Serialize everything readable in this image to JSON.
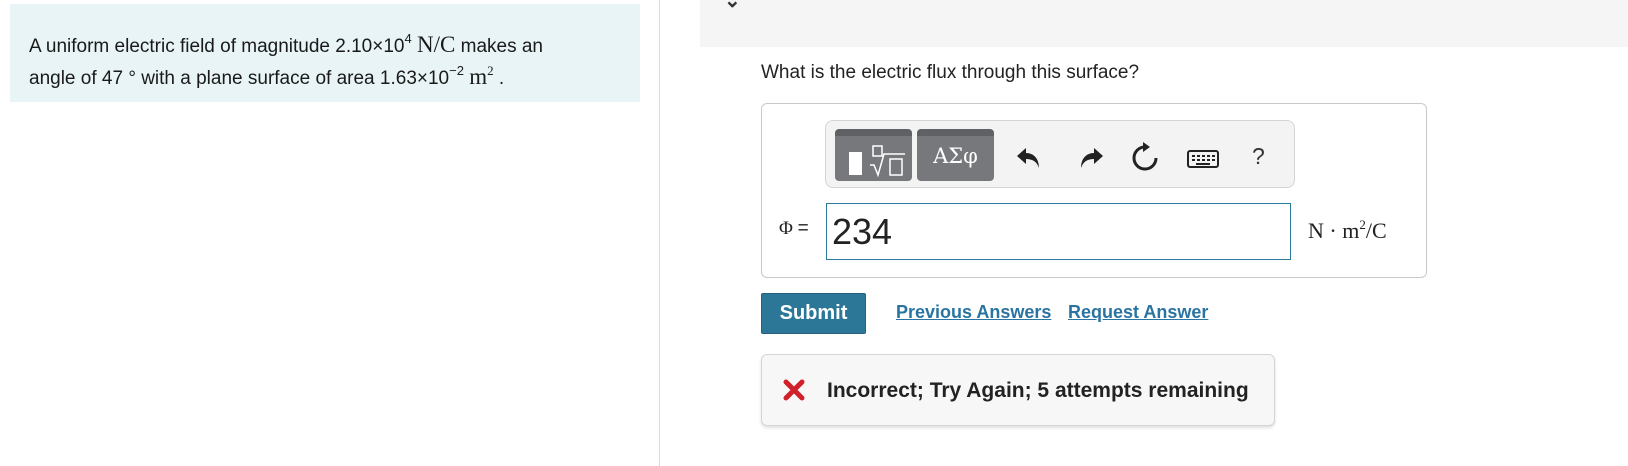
{
  "problem": {
    "line1_prefix": "A uniform electric field of magnitude 2.10×10",
    "line1_exp": "4",
    "line1_unit": "N/C",
    "line1_suffix": "makes an",
    "line2_prefix": "angle of 47",
    "line2_degree": "°",
    "line2_mid": "with a plane surface of area 1.63×10",
    "line2_exp": "−2",
    "line2_unit": "m",
    "line2_unit_exp": "2",
    "line2_end": "."
  },
  "question": "What is the electric flux through this surface?",
  "toolbar": {
    "greek_label": "ΑΣφ",
    "help_label": "?",
    "icons": [
      "templates-icon",
      "greek-letters-icon",
      "undo-icon",
      "redo-icon",
      "reset-icon",
      "keyboard-icon",
      "help-icon"
    ]
  },
  "answer": {
    "variable": "Φ",
    "equals": "=",
    "value": "234",
    "units_prefix": "N · m",
    "units_exp": "2",
    "units_suffix": "/C"
  },
  "actions": {
    "submit_label": "Submit",
    "previous_answers_label": "Previous Answers",
    "request_answer_label": "Request Answer"
  },
  "feedback": {
    "message": "Incorrect; Try Again; 5 attempts remaining",
    "status_color": "#d0202a"
  },
  "colors": {
    "problem_bg": "#e8f4f6",
    "accent": "#2c7798",
    "link": "#2a74a2"
  }
}
